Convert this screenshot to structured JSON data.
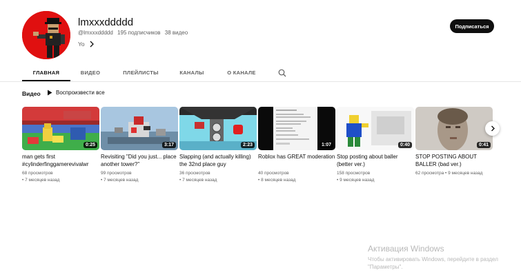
{
  "channel": {
    "name": "lmxxxddddd",
    "handle": "@lmxxxddddd",
    "subscribers": "195 подписчиков",
    "videos_count": "38 видео",
    "about": "Yo",
    "subscribe_label": "Подписаться",
    "avatar_color": "#e01010"
  },
  "tabs": [
    {
      "label": "ГЛАВНАЯ",
      "active": true
    },
    {
      "label": "ВИДЕО",
      "active": false
    },
    {
      "label": "ПЛЕЙЛИСТЫ",
      "active": false
    },
    {
      "label": "КАНАЛЫ",
      "active": false
    },
    {
      "label": "О КАНАЛЕ",
      "active": false
    }
  ],
  "shelf": {
    "title": "Видео",
    "play_all": "Воспроизвести все"
  },
  "videos": [
    {
      "title": "man gets first #cylinderfinggamerevivalwr",
      "duration": "0:25",
      "views": "68 просмотров",
      "age": "7 месяцев назад"
    },
    {
      "title": "Revisiting \"Did you just... place another tower?\"",
      "duration": "3:17",
      "views": "99 просмотров",
      "age": "7 месяцев назад"
    },
    {
      "title": "Slapping (and actually killing) the 32nd place guy",
      "duration": "2:23",
      "views": "36 просмотров",
      "age": "7 месяцев назад"
    },
    {
      "title": "Roblox has GREAT moderation",
      "duration": "1:07",
      "views": "40 просмотров",
      "age": "8 месяцев назад"
    },
    {
      "title": "Stop posting about baller (better ver.)",
      "duration": "0:40",
      "views": "158 просмотров",
      "age": "9 месяцев назад"
    },
    {
      "title": "STOP POSTING ABOUT BALLER (bad ver.)",
      "duration": "0:41",
      "views": "62 просмотра",
      "age": "9 месяцев назад"
    }
  ],
  "watermark": {
    "title": "Активация Windows",
    "text": "Чтобы активировать Windows, перейдите в раздел \"Параметры\"."
  },
  "icons": {
    "search": "search-icon",
    "play": "play-icon",
    "chevron_right": "chevron-right-icon"
  }
}
